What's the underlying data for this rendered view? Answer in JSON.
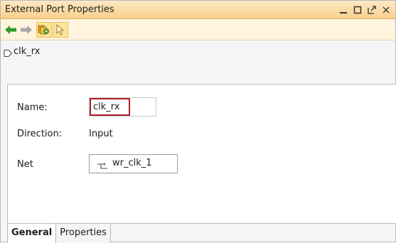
{
  "window": {
    "title": "External Port Properties",
    "controls": {
      "minimize_icon": "minimize-icon",
      "maximize_icon": "maximize-icon",
      "float_icon": "float-icon",
      "close_icon": "close-icon"
    }
  },
  "toolbar": {
    "back_icon": "back-arrow-icon",
    "forward_icon": "forward-arrow-icon",
    "auto_update_icon": "auto-update-icon",
    "select_icon": "select-pointer-icon"
  },
  "path": {
    "port_icon": "port-icon",
    "label": "clk_rx"
  },
  "general": {
    "name_label": "Name:",
    "name_value": "clk_rx",
    "direction_label": "Direction:",
    "direction_value": "Input",
    "net_label": "Net",
    "net_value": "wr_clk_1",
    "net_icon": "net-icon"
  },
  "tabs": [
    {
      "label": "General",
      "active": true
    },
    {
      "label": "Properties",
      "active": false
    }
  ],
  "colors": {
    "title_bg": "#f8cf8a",
    "toolbar_bg": "#fff4de",
    "name_highlight": "#b11e2b",
    "back_arrow": "#2e9c2e",
    "forward_arrow": "#9a9a9a"
  }
}
